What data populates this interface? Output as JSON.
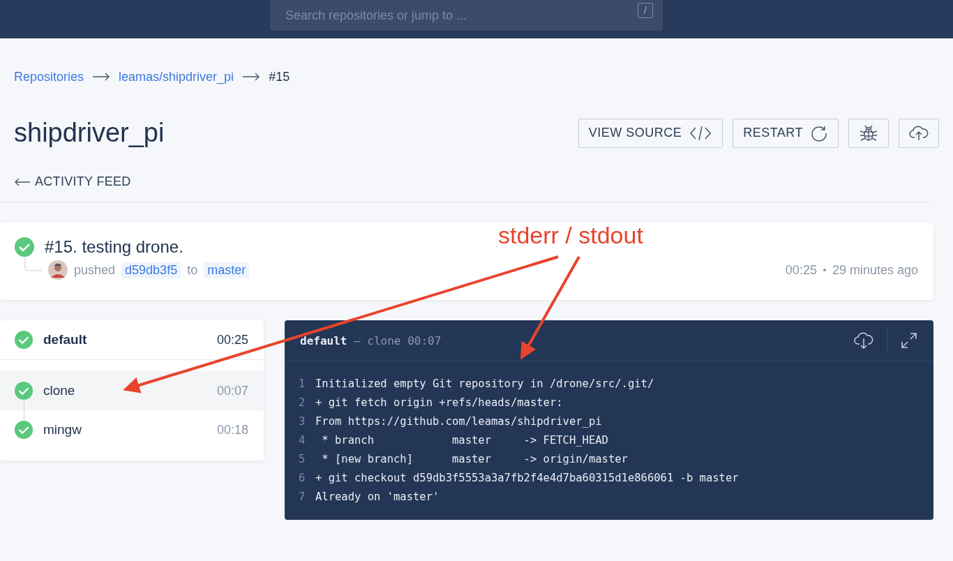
{
  "topbar": {
    "search": {
      "placeholder": "Search repositories or jump to ...",
      "shortcut": "/"
    }
  },
  "breadcrumb": [
    {
      "label": "Repositories"
    },
    {
      "label": "leamas/shipdriver_pi"
    },
    {
      "label": "#15"
    }
  ],
  "repo": {
    "title": "shipdriver_pi",
    "actions": [
      {
        "kind": "source",
        "label": "VIEW SOURCE"
      },
      {
        "kind": "restart",
        "label": "RESTART"
      },
      {
        "kind": "debug"
      },
      {
        "kind": "upload"
      }
    ]
  },
  "back_link": "ACTIVITY FEED",
  "build": {
    "title": "#15. testing drone.",
    "action": "pushed",
    "commit": "d59db3f5",
    "to": "to",
    "branch": "master",
    "duration": "00:25",
    "age": "29 minutes ago"
  },
  "stages": [
    {
      "kind": "stage",
      "name": "default",
      "duration": "00:25",
      "selected": false
    },
    {
      "kind": "step",
      "name": "clone",
      "duration": "00:07",
      "selected": true
    },
    {
      "kind": "step",
      "name": "mingw",
      "duration": "00:18",
      "selected": false
    }
  ],
  "log": {
    "stage": "default",
    "separator": "—",
    "step": "clone",
    "duration": "00:07",
    "lines": [
      {
        "number": "1",
        "text": "Initialized empty Git repository in /drone/src/.git/"
      },
      {
        "number": "2",
        "text": "+ git fetch origin +refs/heads/master:"
      },
      {
        "number": "3",
        "text": "From https://github.com/leamas/shipdriver_pi"
      },
      {
        "number": "4",
        "text": " * branch            master     -> FETCH_HEAD"
      },
      {
        "number": "5",
        "text": " * [new branch]      master     -> origin/master"
      },
      {
        "number": "6",
        "text": "+ git checkout d59db3f5553a3a7fb2f4e4d7ba60315d1e866061 -b master"
      },
      {
        "number": "7",
        "text": "Already on 'master'"
      }
    ]
  },
  "annotation": {
    "label": "stderr / stdout",
    "color": "#e8442c"
  }
}
